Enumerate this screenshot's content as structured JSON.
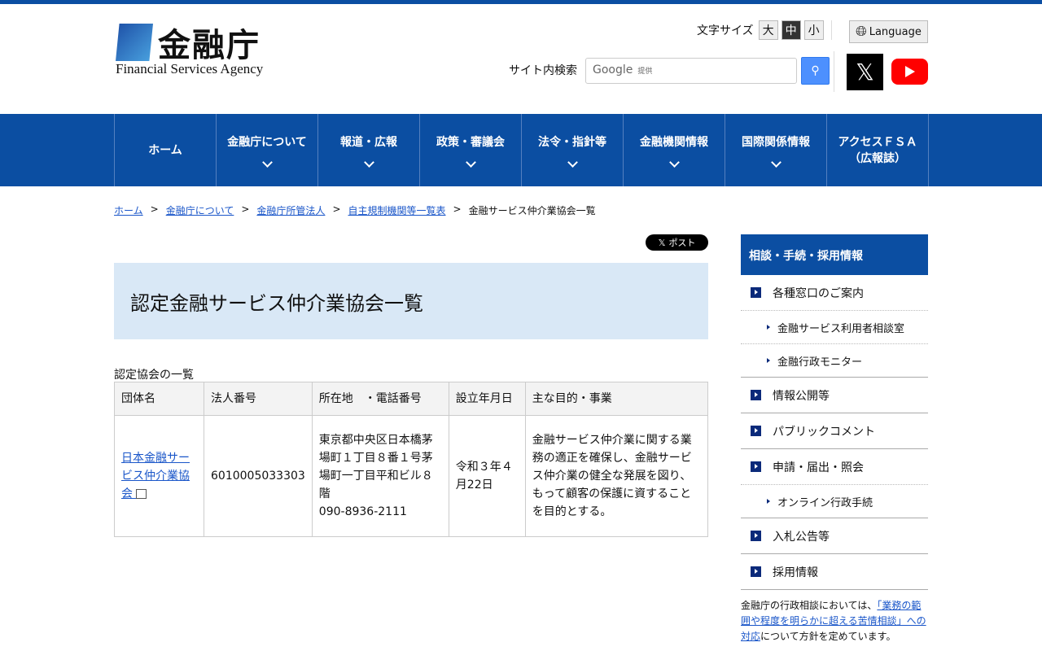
{
  "header": {
    "logo_kanji": "金融庁",
    "logo_en": "Financial Services Agency",
    "font_size_label": "文字サイズ",
    "font_sizes": [
      "大",
      "中",
      "小"
    ],
    "language": "Language",
    "search_label": "サイト内検索",
    "search_placeholder": "Google",
    "search_provider": "提供"
  },
  "nav": [
    {
      "label": "ホーム"
    },
    {
      "label": "金融庁について"
    },
    {
      "label": "報道・広報"
    },
    {
      "label": "政策・審議会"
    },
    {
      "label": "法令・指針等"
    },
    {
      "label": "金融機関情報"
    },
    {
      "label": "国際関係情報"
    },
    {
      "label": "アクセスＦＳＡ\n（広報誌）"
    }
  ],
  "breadcrumb": [
    "ホーム",
    "金融庁について",
    "金融庁所管法人",
    "自主規制機関等一覧表",
    "金融サービス仲介業協会一覧"
  ],
  "post": "ポスト",
  "title": "認定金融サービス仲介業協会一覧",
  "caption": "認定協会の一覧",
  "table": {
    "headers": [
      "団体名",
      "法人番号",
      "所在地　・電話番号",
      "設立年月日",
      "主な目的・事業"
    ],
    "row": {
      "name": "日本金融サービス仲介業協会",
      "number": "6010005033303",
      "address": "東京都中央区日本橋茅場町１丁目８番１号茅場町一丁目平和ビル８階",
      "phone": "090-8936-2111",
      "date": "令和３年４月22日",
      "purpose": "金融サービス仲介業に関する業務の適正を確保し、金融サービス仲介業の健全な発展を図り、もって顧客の保護に資することを目的とする。"
    }
  },
  "sidebar": {
    "title": "相談・手続・採用情報",
    "items": [
      {
        "label": "各種窓口のご案内"
      },
      {
        "label": "金融サービス利用者相談室"
      },
      {
        "label": "金融行政モニター"
      },
      {
        "label": "情報公開等"
      },
      {
        "label": "パブリックコメント"
      },
      {
        "label": "申請・届出・照会"
      },
      {
        "label": "オンライン行政手続"
      },
      {
        "label": "入札公告等"
      },
      {
        "label": "採用情報"
      }
    ],
    "note_pre": "金融庁の行政相談においては、",
    "note_link": "「業務の範囲や程度を明らかに超える苦情相談」への対応",
    "note_post": "について方針を定めています。"
  }
}
